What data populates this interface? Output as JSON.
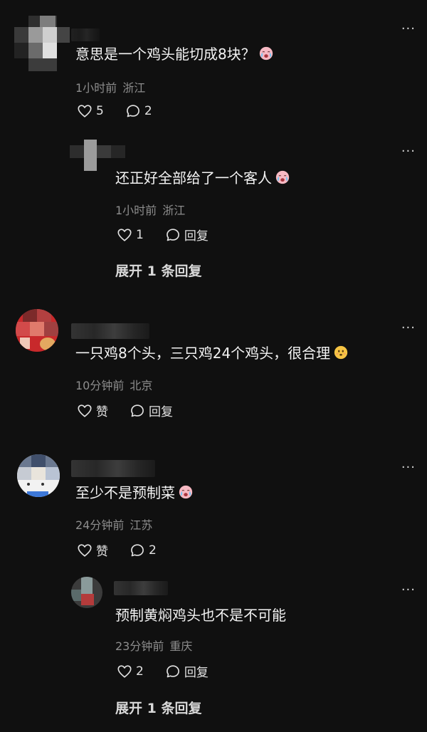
{
  "comments": [
    {
      "text": "意思是一个鸡头能切成8块？",
      "emoji": "crying-face-emoji",
      "time": "1小时前",
      "location": "浙江",
      "likes": "5",
      "replies": "2",
      "more": "···"
    },
    {
      "text": "还正好全部给了一个客人",
      "emoji": "crying-face-emoji",
      "time": "1小时前",
      "location": "浙江",
      "likes": "1",
      "replies": "回复",
      "more": "···",
      "expand": "展开 1 条回复"
    },
    {
      "text": "一只鸡8个头，三只鸡24个鸡头，很合理",
      "emoji": "thinking-face-emoji",
      "time": "10分钟前",
      "location": "北京",
      "likes": "赞",
      "replies": "回复",
      "more": "···"
    },
    {
      "text": "至少不是预制菜",
      "emoji": "crying-face-emoji",
      "time": "24分钟前",
      "location": "江苏",
      "likes": "赞",
      "replies": "2",
      "more": "···"
    },
    {
      "text": "预制黄焖鸡头也不是不可能",
      "time": "23分钟前",
      "location": "重庆",
      "likes": "2",
      "replies": "回复",
      "more": "···",
      "expand": "展开 1 条回复"
    }
  ],
  "colors": {
    "background": "#101010",
    "text": "#f3f3f3",
    "meta": "#8d8d8d"
  }
}
